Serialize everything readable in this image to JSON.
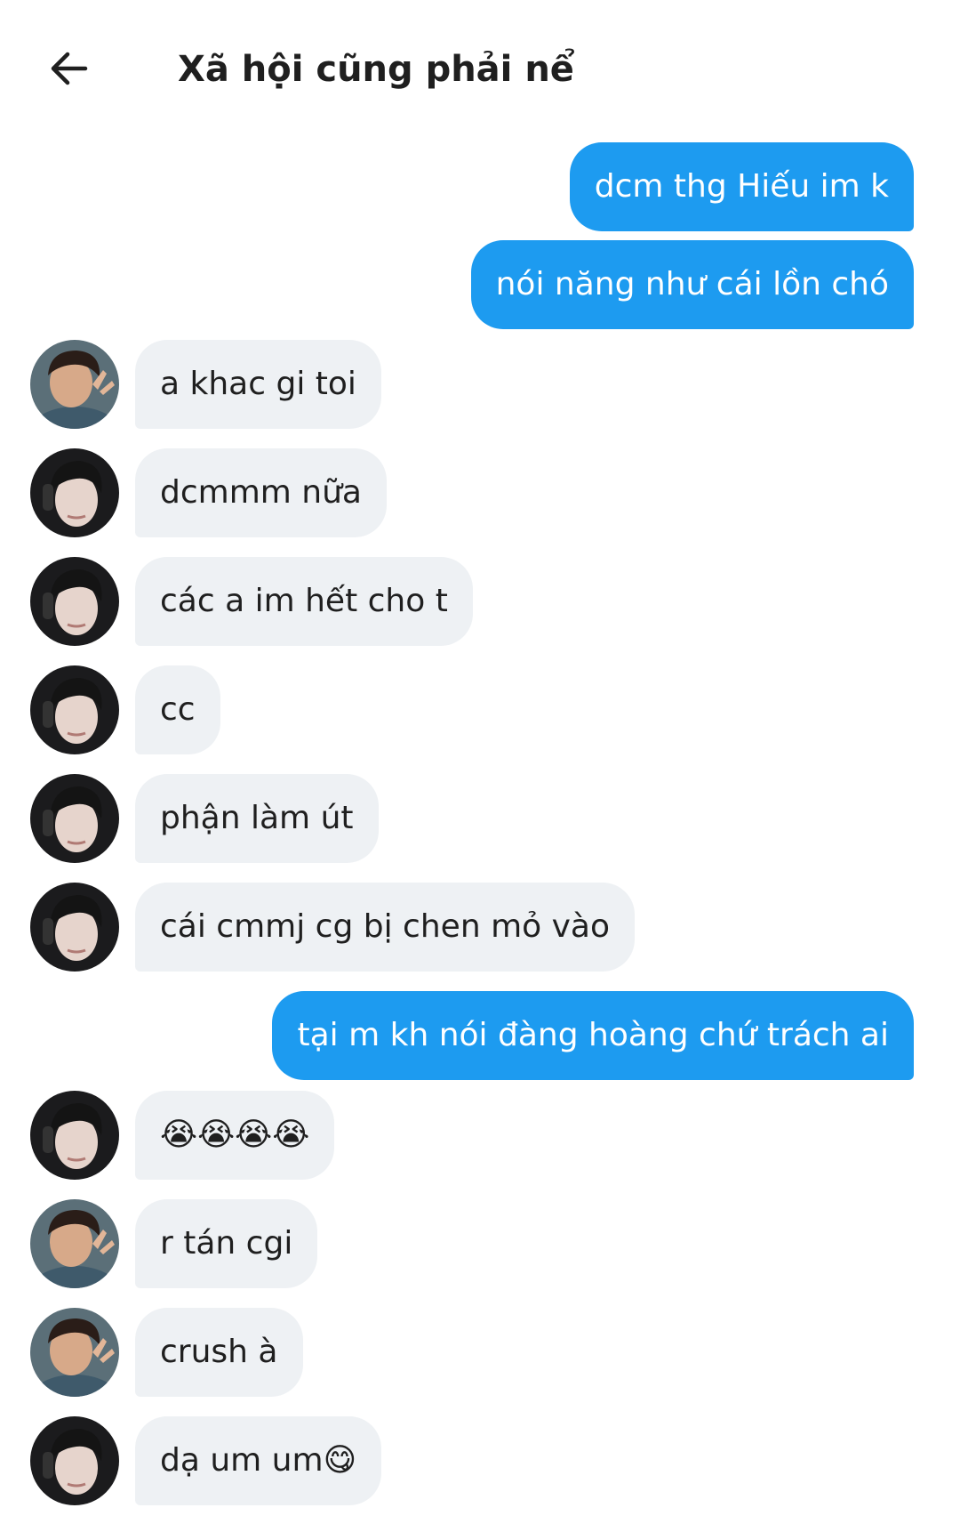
{
  "header": {
    "back_icon": "arrow-left-icon",
    "title": "Xã hội cũng phải nể"
  },
  "colors": {
    "sent_bubble": "#1d9bf0",
    "received_bubble": "#eef1f4",
    "sent_text": "#ffffff",
    "received_text": "#1f1f1f"
  },
  "messages": [
    {
      "direction": "sent",
      "text": "dcm thg Hiếu im k"
    },
    {
      "direction": "sent",
      "text": "nói năng như cái lồn chó"
    },
    {
      "direction": "received",
      "sender": "user-a",
      "text": "a khac gi toi"
    },
    {
      "direction": "received",
      "sender": "user-b",
      "text": "dcmmm nữa"
    },
    {
      "direction": "received",
      "sender": "user-b",
      "text": "các a im hết cho t"
    },
    {
      "direction": "received",
      "sender": "user-b",
      "text": "cc"
    },
    {
      "direction": "received",
      "sender": "user-b",
      "text": "phận làm út"
    },
    {
      "direction": "received",
      "sender": "user-b",
      "text": "cái cmmj cg bị chen mỏ vào"
    },
    {
      "direction": "sent",
      "text": "tại m kh nói đàng hoàng chứ trách ai"
    },
    {
      "direction": "received",
      "sender": "user-b",
      "text": "😭😭😭😭"
    },
    {
      "direction": "received",
      "sender": "user-a",
      "text": "r tán cgi"
    },
    {
      "direction": "received",
      "sender": "user-a",
      "text": "crush à"
    },
    {
      "direction": "received",
      "sender": "user-b",
      "text": "dạ um um😋"
    }
  ]
}
